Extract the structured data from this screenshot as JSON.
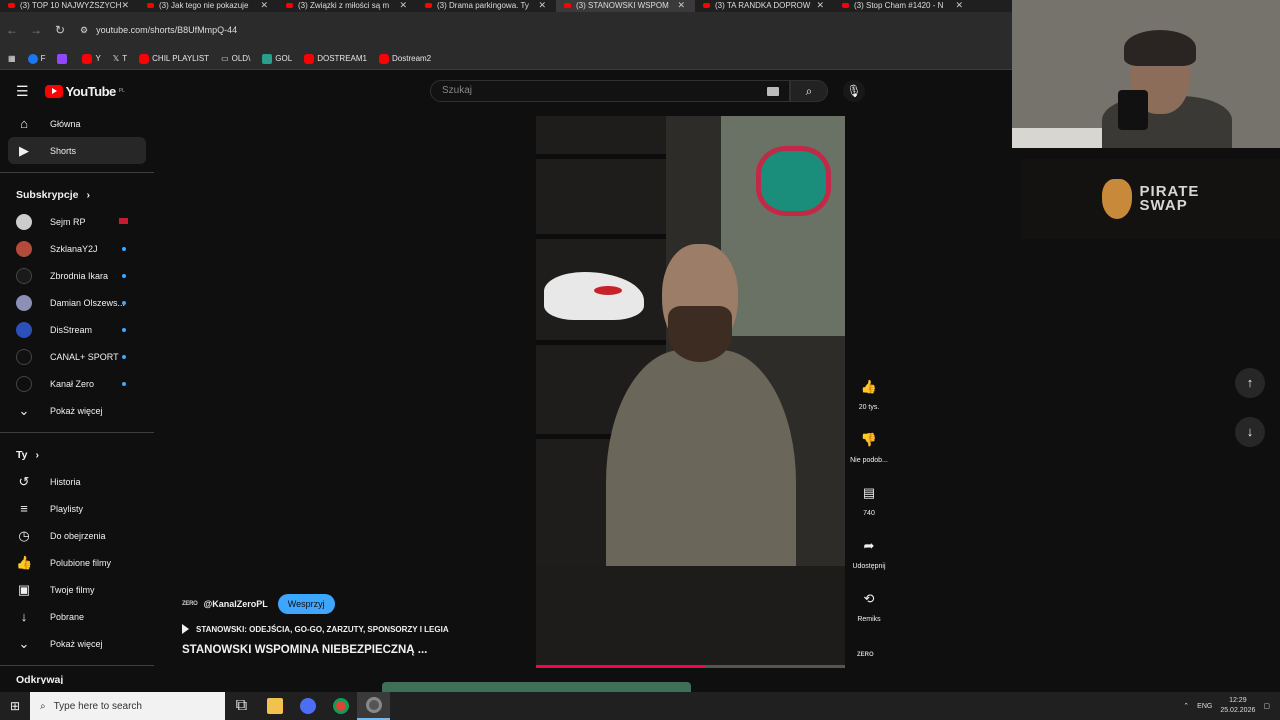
{
  "browser": {
    "tabs": [
      {
        "label": "(3) TOP 10 NAJWYŻSZYCH"
      },
      {
        "label": "(3) Jak tego nie pokazuje"
      },
      {
        "label": "(3) Związki z miłości są m"
      },
      {
        "label": "(3) Drama parkingowa. Ty"
      },
      {
        "label": "(3) STANOWSKI WSPOM"
      },
      {
        "label": "(3) TA RANDKA DOPROW"
      },
      {
        "label": "(3) Stop Cham #1420 - N"
      }
    ],
    "active_tab": 4,
    "url": "youtube.com/shorts/B8UfMmpQ-44",
    "bookmarks": [
      {
        "label": "F"
      },
      {
        "label": ""
      },
      {
        "label": "Y"
      },
      {
        "label": "T"
      },
      {
        "label": "CHIL PLAYLIST"
      },
      {
        "label": "OLD\\"
      },
      {
        "label": "GOL"
      },
      {
        "label": "DOSTREAM1"
      },
      {
        "label": "Dostream2"
      }
    ]
  },
  "youtube": {
    "logo_text": "YouTube",
    "region": "PL",
    "search_placeholder": "Szukaj",
    "nav": [
      {
        "label": "Główna",
        "icon": "home-icon"
      },
      {
        "label": "Shorts",
        "icon": "shorts-icon"
      }
    ],
    "subs_header": "Subskrypcje",
    "subscriptions": [
      {
        "label": "Sejm RP",
        "color": "#cccccc"
      },
      {
        "label": "SzklanaY2J",
        "color": "#b44a3a"
      },
      {
        "label": "Zbrodnia Ikara",
        "color": "#1a1a1a"
      },
      {
        "label": "Damian Olszews...",
        "color": "#8d8fb5"
      },
      {
        "label": "DisStream",
        "color": "#2d4fb8"
      },
      {
        "label": "CANAL+ SPORT",
        "color": "#111111"
      },
      {
        "label": "Kanał Zero",
        "color": "#0f0f0f"
      }
    ],
    "show_more": "Pokaż więcej",
    "you_header": "Ty",
    "you_items": [
      {
        "label": "Historia",
        "icon": "history-icon"
      },
      {
        "label": "Playlisty",
        "icon": "playlist-icon"
      },
      {
        "label": "Do obejrzenia",
        "icon": "clock-icon"
      },
      {
        "label": "Polubione filmy",
        "icon": "like-icon"
      },
      {
        "label": "Twoje filmy",
        "icon": "video-icon"
      },
      {
        "label": "Pobrane",
        "icon": "download-icon"
      }
    ],
    "show_more_2": "Pokaż więcej",
    "cut_header": "Odkrywaj"
  },
  "short": {
    "channel_logo": "ZERO",
    "channel": "@KanalZeroPL",
    "support_label": "Wesprzyj",
    "sound": "STANOWSKI: ODEJŚCIA, GO-GO, ZARZUTY, SPONSORZY I LEGIA",
    "title": "STANOWSKI WSPOMINA NIEBEZPIECZNĄ ...",
    "progress": 0.55,
    "actions": {
      "likes": "20 tys.",
      "dislike": "Nie podob...",
      "comments": "740",
      "share": "Udostępnij",
      "remix": "Remiks"
    },
    "footer_logo": "ZERO"
  },
  "overlay": {
    "sponsor_line1": "PIRATE",
    "sponsor_line2": "SWAP"
  },
  "taskbar": {
    "search_placeholder": "Type here to search",
    "lang": "ENG",
    "time": "12:29",
    "date": "25.02.2026"
  }
}
